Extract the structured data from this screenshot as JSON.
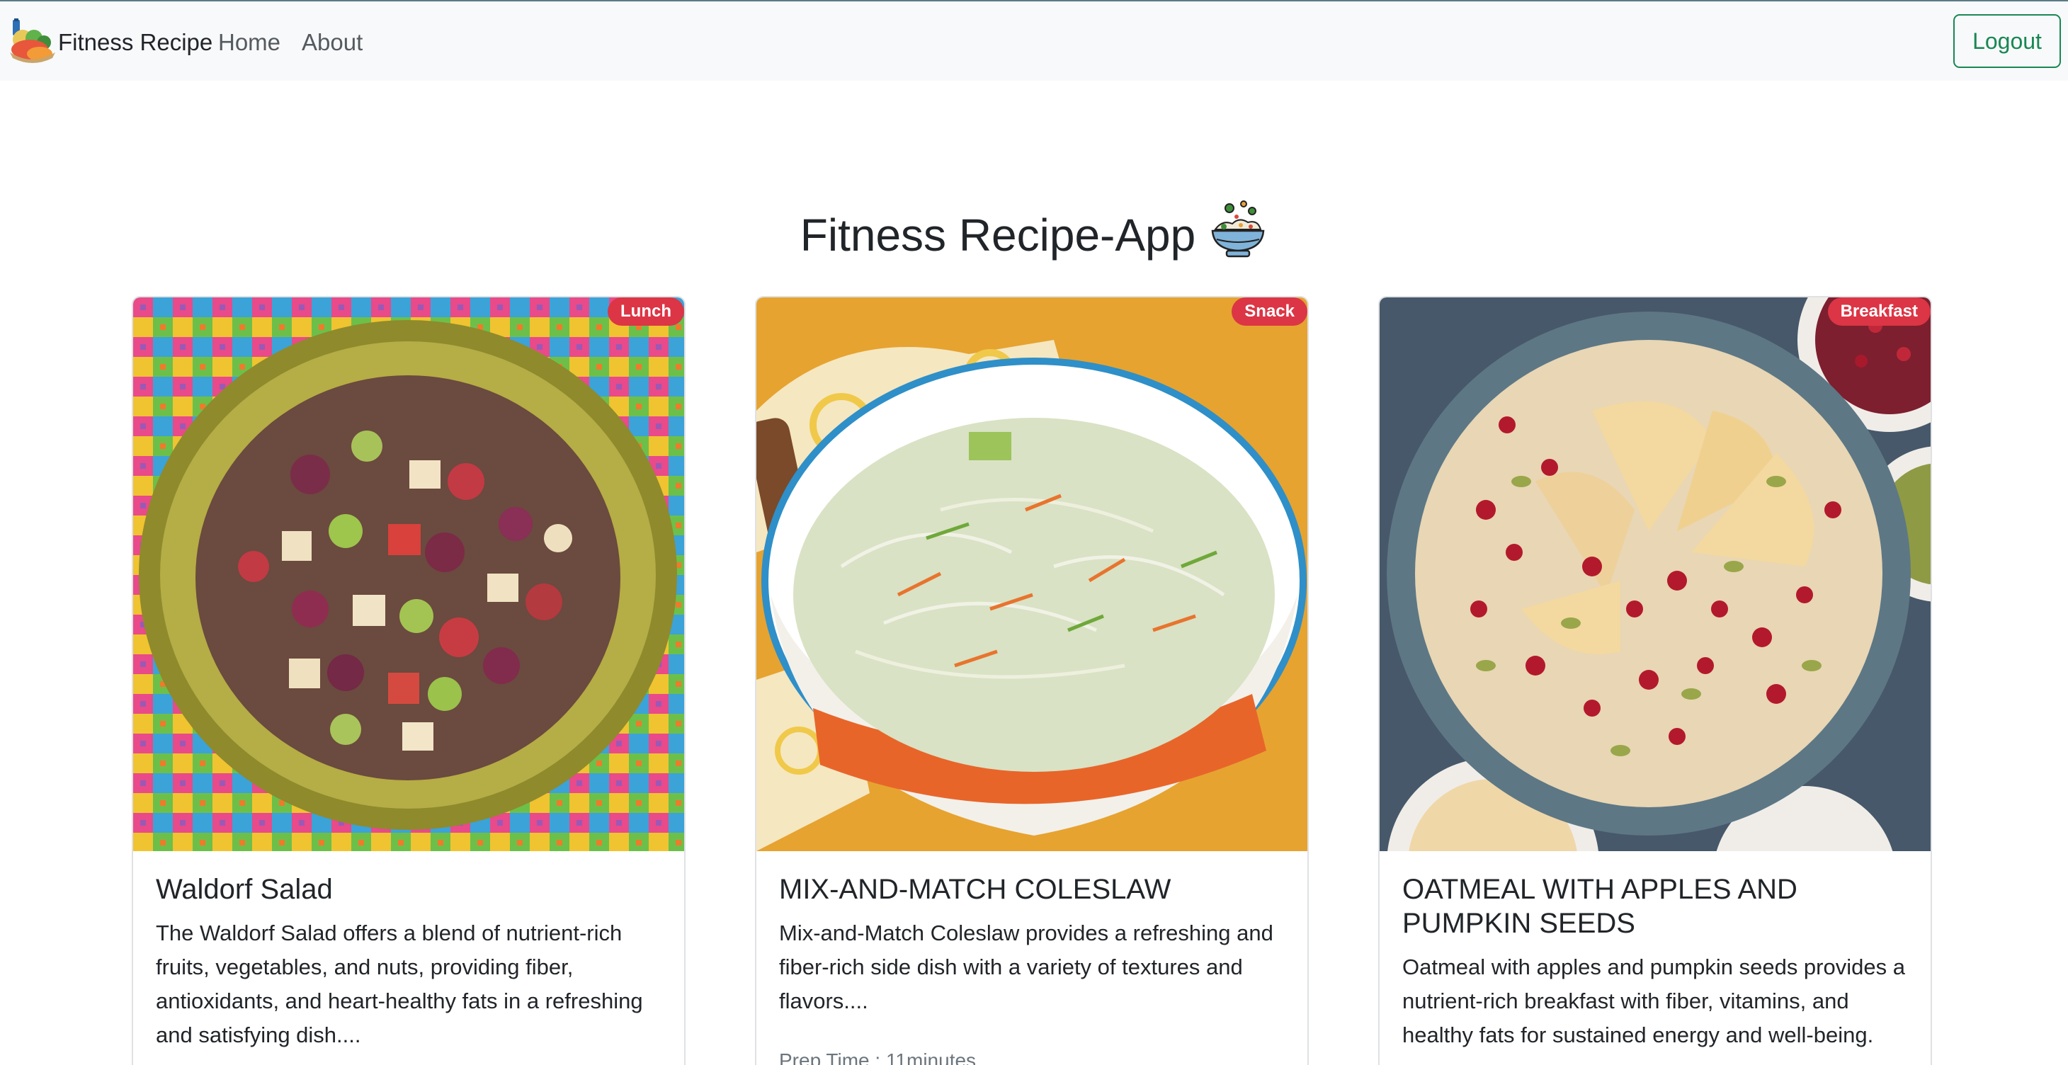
{
  "navbar": {
    "brand": "Fitness Recipe",
    "links": [
      {
        "label": "Home"
      },
      {
        "label": "About"
      }
    ],
    "logout_label": "Logout"
  },
  "page": {
    "title": "Fitness Recipe-App"
  },
  "colors": {
    "navbar_bg": "#f8f9fa",
    "logout_green": "#198754",
    "badge_red": "#dc3545"
  },
  "recipes": [
    {
      "category": "Lunch",
      "title": "Waldorf Salad",
      "description": "The Waldorf Salad offers a blend of nutrient-rich fruits, vegetables, and nuts, providing fiber, antioxidants, and heart-healthy fats in a refreshing and satisfying dish....",
      "image": "waldorf-salad-photo"
    },
    {
      "category": "Snack",
      "title": "MIX-AND-MATCH COLESLAW",
      "description": "Mix-and-Match Coleslaw provides a refreshing and fiber-rich side dish with a variety of textures and flavors....",
      "prep_time": "Prep Time : 11minutes",
      "image": "coleslaw-photo"
    },
    {
      "category": "Breakfast",
      "title": "OATMEAL WITH APPLES AND PUMPKIN SEEDS",
      "description": "Oatmeal with apples and pumpkin seeds provides a nutrient-rich breakfast with fiber, vitamins, and healthy fats for sustained energy and well-being.",
      "image": "oatmeal-photo"
    }
  ]
}
